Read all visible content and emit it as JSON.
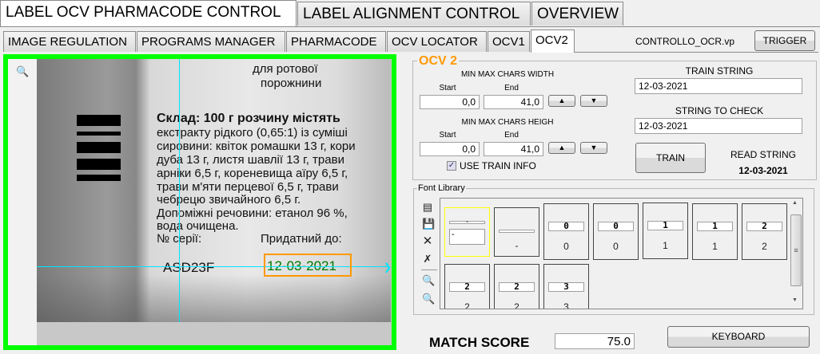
{
  "main_tabs": [
    {
      "label": "LABEL OCV PHARMACODE CONTROL",
      "active": true
    },
    {
      "label": "LABEL ALIGNMENT CONTROL",
      "active": false
    },
    {
      "label": "OVERVIEW",
      "active": false
    }
  ],
  "sub_tabs": [
    {
      "label": "IMAGE REGULATION"
    },
    {
      "label": "PROGRAMS MANAGER"
    },
    {
      "label": "PHARMACODE"
    },
    {
      "label": "OCV LOCATOR"
    },
    {
      "label": "OCV1"
    },
    {
      "label": "OCV2",
      "active": true
    }
  ],
  "file_name": "CONTROLLO_OCR.vp",
  "trigger_label": "TRIGGER",
  "image": {
    "border_color": "#00ff00",
    "photo_text": [
      "для ротової",
      "порожнини",
      "Склад: 100 г розчину містять",
      "екстракту рідкого (0,65:1) із суміші",
      "сировини: квіток ромашки 13 г, кори",
      "дуба 13 г, листя шавлії 13 г, трави",
      "арніки 6,5 г, кореневища аїру 6,5 г,",
      "трави м'яти перцевої 6,5 г, трави",
      "чебрецю звичайного 6,5 г.",
      "Допоміжні речовини: етанол 96 %,",
      "вода очищена.",
      "№ серії:",
      "Придатний до:",
      "ASD23F",
      "12-03-2021"
    ]
  },
  "ocv": {
    "title": "OCV 2",
    "width_label": "MIN MAX CHARS WIDTH",
    "height_label": "MIN MAX CHARS HEIGH",
    "start_label": "Start",
    "end_label": "End",
    "width_start": "0,0",
    "width_end": "41,0",
    "height_start": "0,0",
    "height_end": "41,0",
    "use_train_info": "USE TRAIN INFO",
    "use_train_checked": true,
    "train_string_label": "TRAIN STRING",
    "train_string": "12-03-2021",
    "check_string_label": "STRING TO CHECK",
    "check_string": "12-03-2021",
    "train_button": "TRAIN",
    "read_string_label": "READ STRING",
    "read_string": "12-03-2021"
  },
  "font_library": {
    "title": "Font Library",
    "tiles": [
      {
        "glyph": "-",
        "char": "-"
      },
      {
        "glyph": "",
        "char": "-"
      },
      {
        "glyph": "0",
        "char": "0"
      },
      {
        "glyph": "0",
        "char": "0"
      },
      {
        "glyph": "1",
        "char": "1"
      },
      {
        "glyph": "1",
        "char": "1"
      },
      {
        "glyph": "2",
        "char": "2"
      },
      {
        "glyph": "2",
        "char": "2"
      },
      {
        "glyph": "2",
        "char": "2"
      },
      {
        "glyph": "3",
        "char": "3"
      }
    ]
  },
  "match_score_label": "MATCH SCORE",
  "match_score": "75.0",
  "keyboard_label": "KEYBOARD",
  "colors": {
    "accent_orange": "#ff9900",
    "crosshair": "#00e5ff",
    "selected_tile": "#ffff00"
  }
}
